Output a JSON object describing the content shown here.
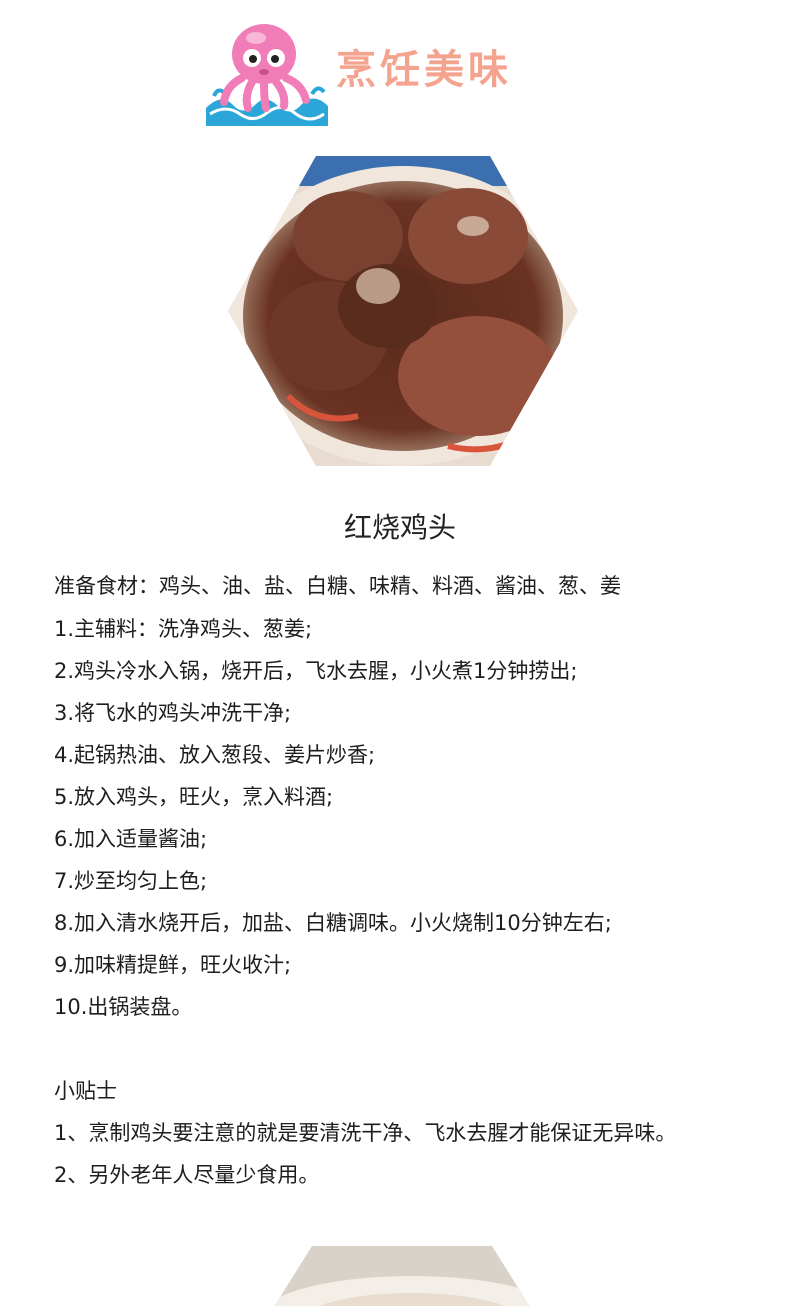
{
  "header": {
    "brand_title": "烹饪美味",
    "logo_icon": "octopus-mascot-icon",
    "colors": {
      "brand_title": "#f4a38f",
      "octopus": "#f07cb8",
      "waves": "#2aa7d8"
    }
  },
  "photo": {
    "icon": "braised-chicken-heads-photo"
  },
  "recipe": {
    "title": "红烧鸡头",
    "ingredients": "准备食材：鸡头、油、盐、白糖、味精、料酒、酱油、葱、姜",
    "steps": [
      "1.主辅料：洗净鸡头、葱姜;",
      "2.鸡头冷水入锅，烧开后，飞水去腥，小火煮1分钟捞出;",
      "3.将飞水的鸡头冲洗干净;",
      "4.起锅热油、放入葱段、姜片炒香;",
      "5.放入鸡头，旺火，烹入料酒;",
      "6.加入适量酱油;",
      "7.炒至均匀上色;",
      "8.加入清水烧开后，加盐、白糖调味。小火烧制10分钟左右;",
      "9.加味精提鲜，旺火收汁;",
      "10.出锅装盘。"
    ],
    "tips_title": "小贴士",
    "tips": [
      "1、烹制鸡头要注意的就是要清洗干净、飞水去腥才能保证无异味。",
      "2、另外老年人尽量少食用。"
    ]
  },
  "next_photo": {
    "icon": "next-dish-photo"
  }
}
